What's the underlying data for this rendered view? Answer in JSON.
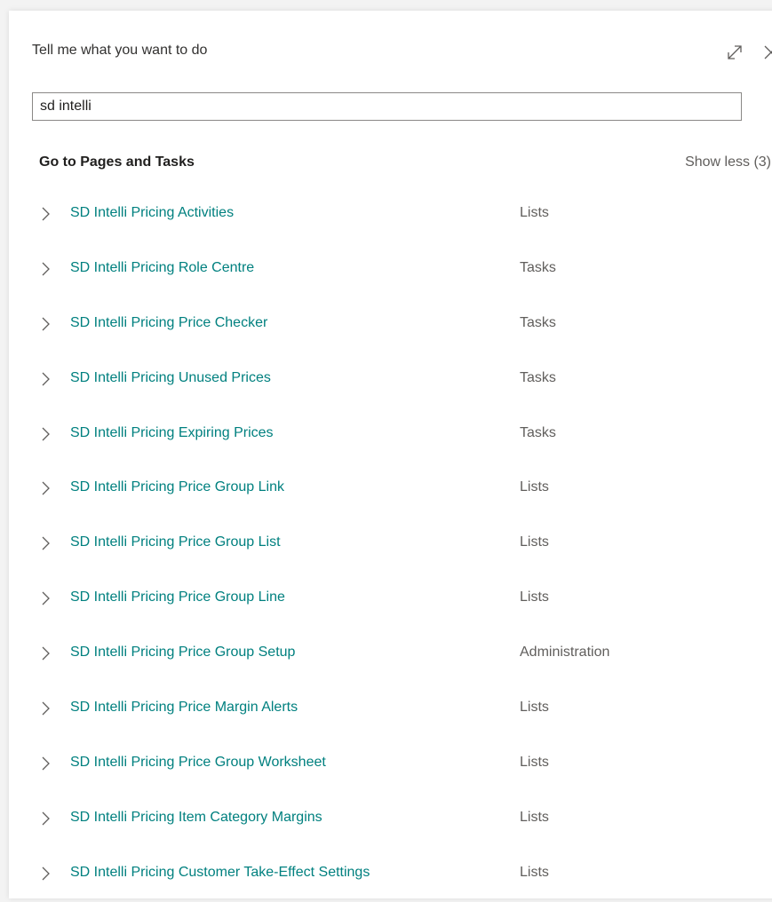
{
  "dialog": {
    "title": "Tell me what you want to do",
    "search_value": "sd intelli",
    "section_header": "Go to Pages and Tasks",
    "show_less_label": "Show less (3)"
  },
  "icons": {
    "expand": "expand-icon",
    "close": "close-icon",
    "chevron": "chevron-right-icon"
  },
  "colors": {
    "link": "#00807f",
    "category": "#605e5c"
  },
  "results": [
    {
      "name": "SD Intelli Pricing Activities",
      "category": "Lists"
    },
    {
      "name": "SD Intelli Pricing Role Centre",
      "category": "Tasks"
    },
    {
      "name": "SD Intelli Pricing Price Checker",
      "category": "Tasks"
    },
    {
      "name": "SD Intelli Pricing Unused Prices",
      "category": "Tasks"
    },
    {
      "name": "SD Intelli Pricing Expiring Prices",
      "category": "Tasks"
    },
    {
      "name": "SD Intelli Pricing Price Group Link",
      "category": "Lists"
    },
    {
      "name": "SD Intelli Pricing Price Group List",
      "category": "Lists"
    },
    {
      "name": "SD Intelli Pricing Price Group Line",
      "category": "Lists"
    },
    {
      "name": "SD Intelli Pricing Price Group Setup",
      "category": "Administration"
    },
    {
      "name": "SD Intelli Pricing Price Margin Alerts",
      "category": "Lists"
    },
    {
      "name": "SD Intelli Pricing Price Group Worksheet",
      "category": "Lists"
    },
    {
      "name": "SD Intelli Pricing Item Category Margins",
      "category": "Lists"
    },
    {
      "name": "SD Intelli Pricing Customer Take-Effect Settings",
      "category": "Lists"
    }
  ]
}
